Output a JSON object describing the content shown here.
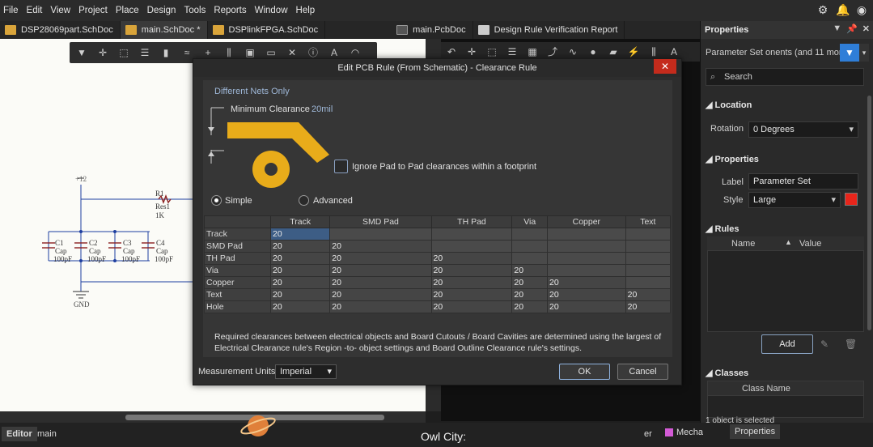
{
  "menu": [
    "File",
    "Edit",
    "View",
    "Project",
    "Place",
    "Design",
    "Tools",
    "Reports",
    "Window",
    "Help"
  ],
  "tabs": [
    {
      "label": "DSP28069part.SchDoc",
      "active": false
    },
    {
      "label": "main.SchDoc *",
      "active": true
    },
    {
      "label": "DSPlinkFPGA.SchDoc",
      "active": false
    },
    {
      "label": "main.PcbDoc",
      "active": false
    },
    {
      "label": "Design Rule Verification Report",
      "active": false
    }
  ],
  "schematic": {
    "power_label": "+12",
    "gnd_label": "GND",
    "resistor": {
      "ref": "R1",
      "name": "Res1",
      "value": "1K"
    },
    "caps": [
      {
        "ref": "C1",
        "name": "Cap",
        "value": "100pF"
      },
      {
        "ref": "C2",
        "name": "Cap",
        "value": "100pF"
      },
      {
        "ref": "C3",
        "name": "Cap",
        "value": "100pF"
      },
      {
        "ref": "C4",
        "name": "Cap",
        "value": "100pF"
      }
    ]
  },
  "dialog": {
    "title": "Edit PCB Rule (From Schematic) - Clearance Rule",
    "close_label": "✕",
    "different_nets": "Different Nets Only",
    "min_clearance_label": "Minimum Clearance",
    "min_clearance_value": "20mil",
    "ignore_pad_label": "Ignore Pad to Pad clearances within a footprint",
    "mode_simple": "Simple",
    "mode_advanced": "Advanced",
    "columns": [
      "Track",
      "SMD Pad",
      "TH Pad",
      "Via",
      "Copper",
      "Text"
    ],
    "rows": [
      {
        "name": "Track",
        "cells": [
          "20"
        ]
      },
      {
        "name": "SMD Pad",
        "cells": [
          "20",
          "20"
        ]
      },
      {
        "name": "TH Pad",
        "cells": [
          "20",
          "20",
          "20"
        ]
      },
      {
        "name": "Via",
        "cells": [
          "20",
          "20",
          "20",
          "20"
        ]
      },
      {
        "name": "Copper",
        "cells": [
          "20",
          "20",
          "20",
          "20",
          "20"
        ]
      },
      {
        "name": "Text",
        "cells": [
          "20",
          "20",
          "20",
          "20",
          "20",
          "20"
        ]
      },
      {
        "name": "Hole",
        "cells": [
          "20",
          "20",
          "20",
          "20",
          "20",
          "20"
        ]
      }
    ],
    "note": "Required clearances between electrical objects and Board Cutouts / Board Cavities are determined using the largest of Electrical Clearance rule's Region -to- object settings and Board Outline Clearance rule's settings.",
    "measurement_label": "Measurement Units",
    "measurement_value": "Imperial",
    "ok_label": "OK",
    "cancel_label": "Cancel"
  },
  "properties": {
    "title": "Properties",
    "filter_text": "Parameter Set   onents (and 11 more)",
    "search_placeholder": "Search",
    "location_title": "Location",
    "rotation_label": "Rotation",
    "rotation_value": "0 Degrees",
    "properties_title": "Properties",
    "label_label": "Label",
    "label_value": "Parameter Set",
    "style_label": "Style",
    "style_value": "Large",
    "style_color": "#e8251b",
    "rules_title": "Rules",
    "rules_col_name": "Name",
    "rules_col_value": "Value",
    "add_label": "Add",
    "classes_title": "Classes",
    "classes_col": "Class Name",
    "footer": "1 object is selected",
    "bottom_tab": "Properties"
  },
  "status": {
    "editor_tab": "Editor",
    "main_tab": "main",
    "caption": "Owl City:",
    "er_text": "er",
    "mecha_label": "Mecha"
  }
}
